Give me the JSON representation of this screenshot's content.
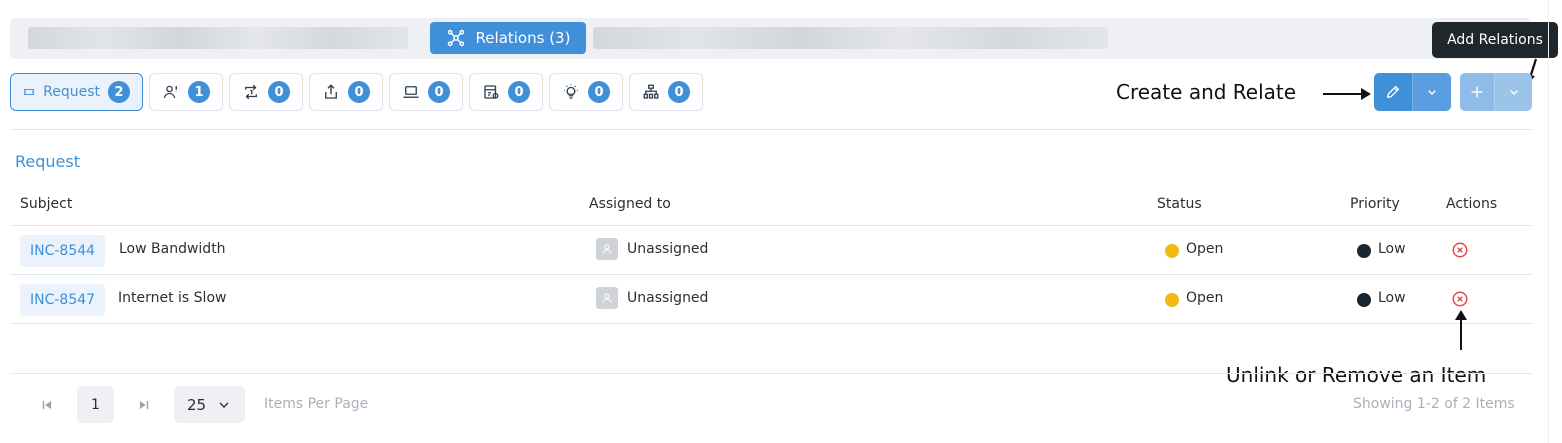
{
  "tabs": {
    "active_label": "Relations (3)",
    "relations_icon": "relations-network-icon"
  },
  "tooltip": "Add Relations",
  "chips": [
    {
      "label": "Request",
      "count": "2",
      "icon": "ticket-icon"
    },
    {
      "label": "",
      "count": "1",
      "icon": "user-alert-icon"
    },
    {
      "label": "",
      "count": "0",
      "icon": "change-arrows-icon"
    },
    {
      "label": "",
      "count": "0",
      "icon": "release-upload-icon"
    },
    {
      "label": "",
      "count": "0",
      "icon": "laptop-icon"
    },
    {
      "label": "",
      "count": "0",
      "icon": "project-board-icon"
    },
    {
      "label": "",
      "count": "0",
      "icon": "idea-bulb-icon"
    },
    {
      "label": "",
      "count": "0",
      "icon": "hierarchy-icon"
    }
  ],
  "annotations": {
    "create_relate": "Create and Relate",
    "unlink": "Unlink or Remove an Item"
  },
  "section_title": "Request",
  "table": {
    "headers": {
      "subject": "Subject",
      "assigned": "Assigned to",
      "status": "Status",
      "priority": "Priority",
      "actions": "Actions"
    },
    "rows": [
      {
        "id": "INC-8544",
        "subject": "Low Bandwidth",
        "assigned": "Unassigned",
        "status": "Open",
        "priority": "Low"
      },
      {
        "id": "INC-8547",
        "subject": "Internet is Slow",
        "assigned": "Unassigned",
        "status": "Open",
        "priority": "Low"
      }
    ]
  },
  "pagination": {
    "page": "1",
    "per_page": "25",
    "per_page_label": "Items Per Page",
    "summary": "Showing 1-2 of 2 Items"
  },
  "colors": {
    "accent": "#3f8fd9",
    "accent_light": "#9cc3ea",
    "status_open": "#f2b90f",
    "priority_low": "#1a2530",
    "remove": "#e5484d"
  }
}
